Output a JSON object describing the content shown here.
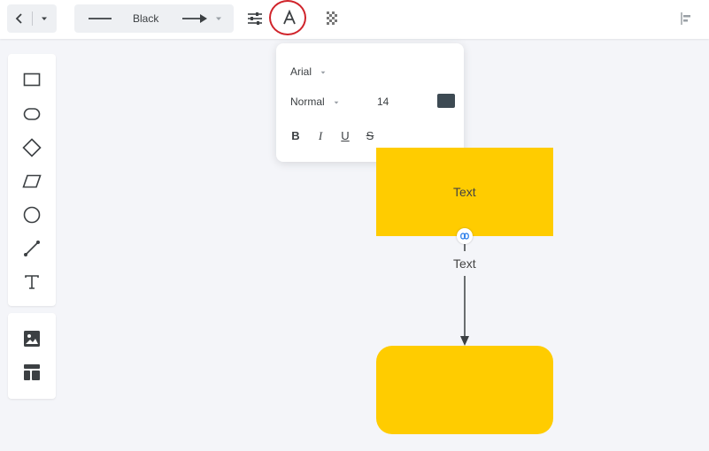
{
  "toolbar": {
    "line_color_label": "Black"
  },
  "text_popover": {
    "font_family": "Arial",
    "font_weight": "Normal",
    "font_size": "14",
    "color": "#3d4a53",
    "format_buttons": {
      "bold": "B",
      "italic": "I",
      "underline": "U",
      "strike": "S"
    }
  },
  "canvas": {
    "rect_text": "Text",
    "connector_text": "Text",
    "shape_color": "#ffcc00"
  },
  "icons": {
    "back": "chevron-left-icon",
    "more": "caret-down-icon",
    "settings": "sliders-icon",
    "text_style": "letter-a-icon",
    "opacity": "checkerboard-icon",
    "align": "align-left-icon"
  }
}
